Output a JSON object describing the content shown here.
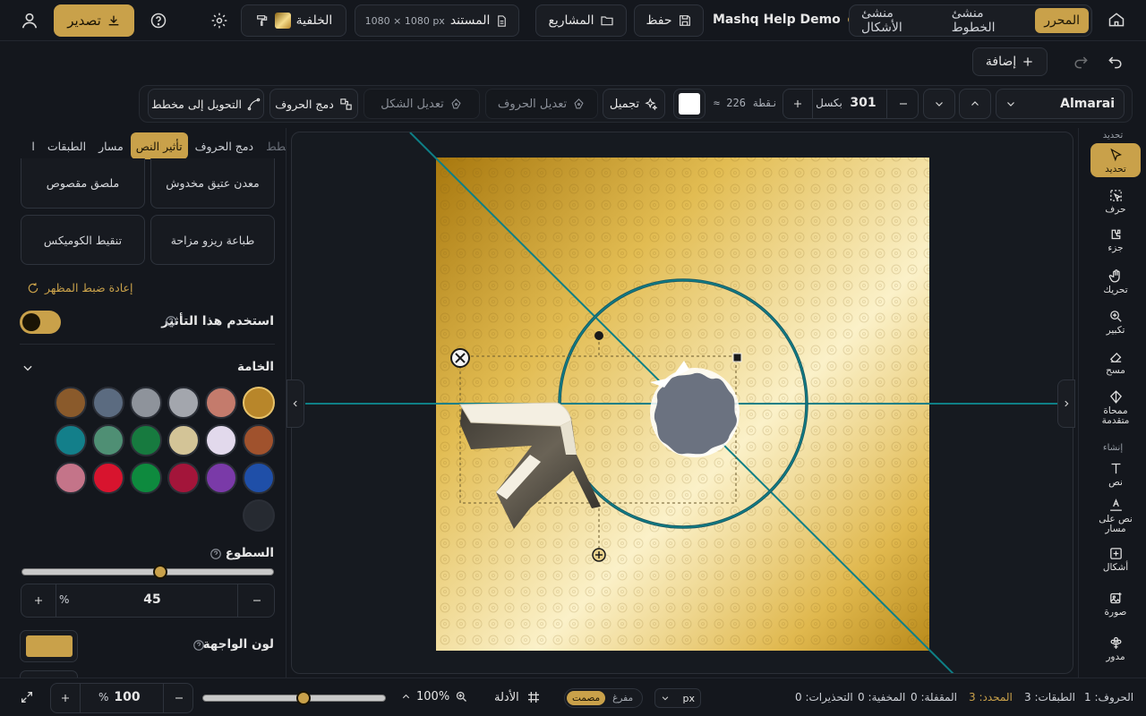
{
  "topbar": {
    "export_label": "تصدير",
    "background_label": "الخلفية",
    "document_label": "المستند",
    "document_size": "1080 × 1080 px",
    "projects_label": "المشاريع",
    "save_label": "حفظ",
    "project_name": "Mashq Help Demo",
    "modes": [
      "المحرر",
      "منشئ الخطوط",
      "منشئ الأشكال"
    ],
    "active_mode": "المحرر"
  },
  "subbar": {
    "add_label": "إضافة"
  },
  "toolbar": {
    "font_name": "Almarai",
    "size_value": "301",
    "size_unit": "بكسل",
    "size_points": "≈ 226 نقطة",
    "beautify_label": "تجميل",
    "edit_letters_label": "تعديل الحروف",
    "edit_shape_label": "تعديل الشكل",
    "merge_letters_label": "دمج الحروف",
    "convert_outline_label": "التحويل إلى مخطط"
  },
  "left_panel": {
    "tabs": [
      "مخطط",
      "دمج الحروف",
      "تأثير النص",
      "مسار",
      "الطبقات",
      "ا"
    ],
    "active_tab": "تأثير النص",
    "presets": [
      "معدن عتيق مخدوش",
      "ملصق مقصوص",
      "طباعة ريزو مزاحة",
      "تنقيط الكوميكس"
    ],
    "reset_label": "إعادة ضبط المظهر",
    "use_effect_label": "استخدم هذا التأثير",
    "material_label": "الخامة",
    "material_swatches": [
      "#b8862a",
      "#c47b6c",
      "#a3a6ad",
      "#8e939b",
      "#5b6b80",
      "#8a5a2b",
      "#a0522d",
      "#e2d9ec",
      "#d3c497",
      "#177a3f",
      "#4f8f74",
      "#137f8a",
      "#1f4fa8",
      "#7a3aa8",
      "#a3153a",
      "#0e8a3e",
      "#d8142e",
      "#c47489",
      "#262a31"
    ],
    "brightness_label": "السطوع",
    "brightness_value": "45",
    "brightness_unit": "%",
    "brightness_fraction": 0.45,
    "face_color_label": "لون الواجهة",
    "face_color": "#c9a14a"
  },
  "tools": [
    {
      "label": "تحديد",
      "icon": "cursor-icon"
    },
    {
      "label": "حرف",
      "icon": "letter-select-icon"
    },
    {
      "label": "جزء",
      "icon": "part-icon"
    },
    {
      "label": "تحريك",
      "icon": "hand-icon"
    },
    {
      "label": "تكبير",
      "icon": "zoom-icon"
    },
    {
      "label": "مسح",
      "icon": "eraser-icon"
    },
    {
      "label": "ممحاة متقدمة",
      "icon": "advanced-eraser-icon"
    },
    {
      "label": "نص",
      "icon": "text-icon"
    },
    {
      "label": "نص على مسار",
      "icon": "text-path-icon"
    },
    {
      "label": "أشكال",
      "icon": "shapes-icon"
    },
    {
      "label": "صورة",
      "icon": "image-icon"
    },
    {
      "label": "مدور",
      "icon": "rotator-icon"
    }
  ],
  "tool_rail": {
    "header_label": "تحديد",
    "create_label": "إنشاء"
  },
  "bottombar": {
    "zoom_value": "100",
    "zoom_unit": "%",
    "zoom_fraction": 0.55,
    "zoom_percent_label": "100%",
    "guides_label": "الأدلة",
    "fill_options": [
      "مصمت",
      "مفرغ"
    ],
    "unit_label": "px",
    "stats": {
      "letters": "الحروف: 1",
      "layers": "الطبقات: 3",
      "selected": "المحدد: 3",
      "locked": "المقفلة: 0",
      "hidden": "المخفية: 0",
      "warnings": "التحذيرات: 0"
    }
  },
  "colors": {
    "accent": "#c9a14a",
    "guide": "#0e7f86"
  }
}
